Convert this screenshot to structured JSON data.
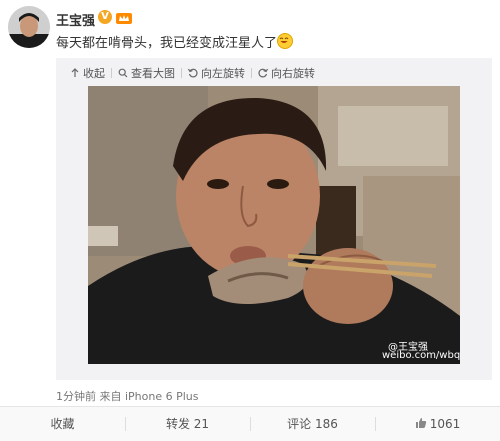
{
  "post": {
    "user_name": "王宝强",
    "badge_v": "V",
    "text": "每天都在啃骨头，我已经变成汪星人了",
    "meta": "1分钟前 来自 iPhone 6 Plus"
  },
  "toolbar": {
    "collapse": "收起",
    "view_large": "查看大图",
    "rotate_left": "向左旋转",
    "rotate_right": "向右旋转"
  },
  "watermark": {
    "brand": "@王宝强",
    "url": "weibo.com/wbq"
  },
  "actions": {
    "favorite": "收藏",
    "repost": "转发 21",
    "comment": "评论 186",
    "like": "1061"
  },
  "colors": {
    "accent": "#f5a623",
    "text": "#333333",
    "muted": "#777777"
  }
}
